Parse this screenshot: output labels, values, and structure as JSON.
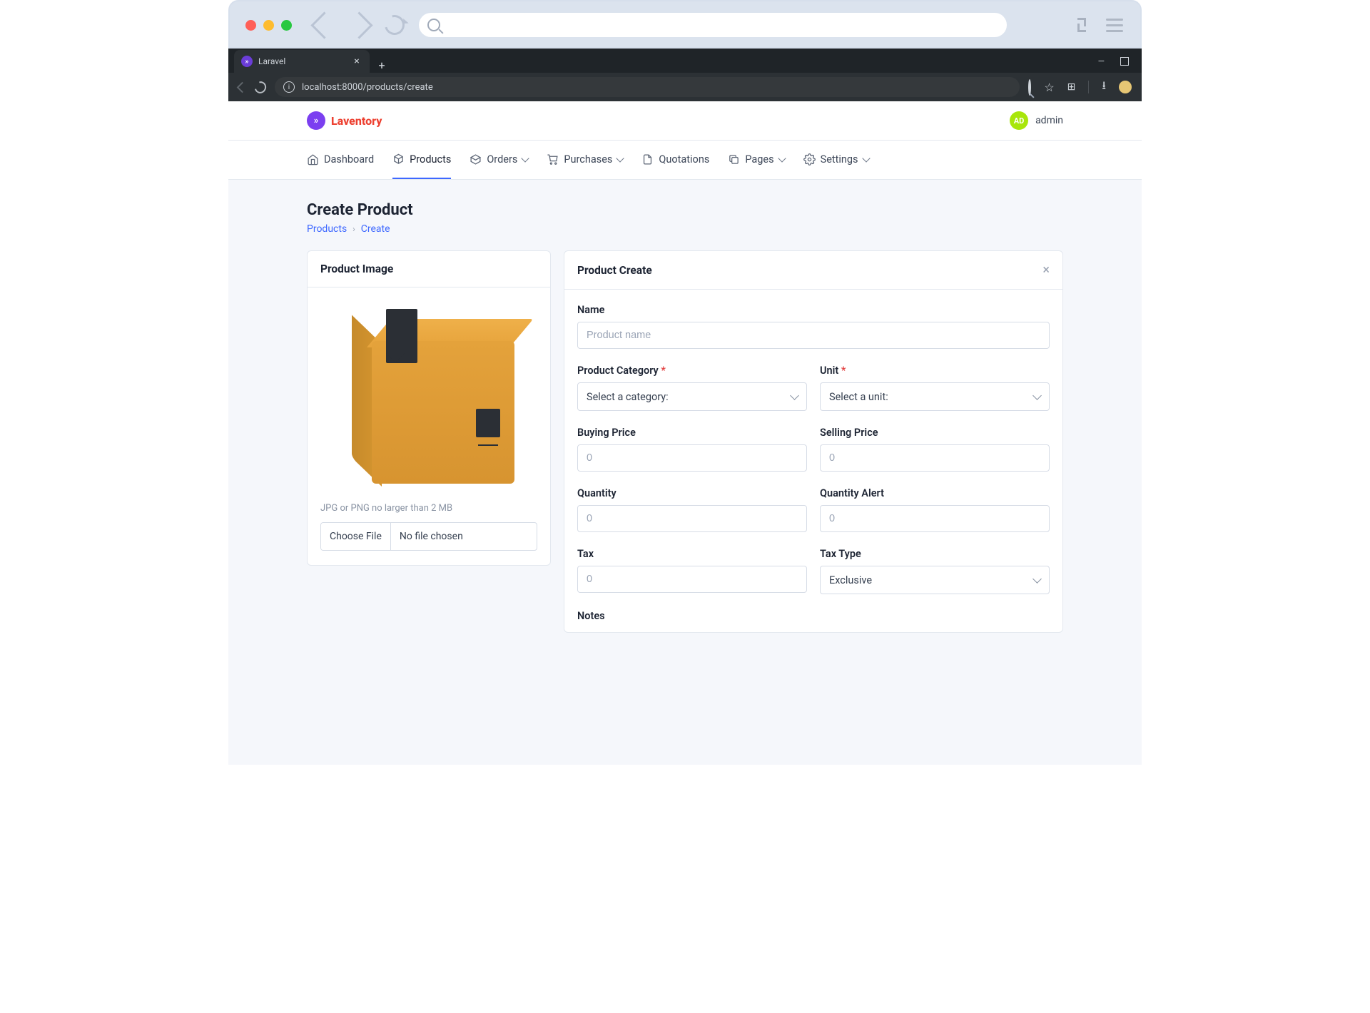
{
  "outer_browser": {
    "search_placeholder": ""
  },
  "inner_browser": {
    "tab_title": "Laravel",
    "url": "localhost:8000/products/create"
  },
  "header": {
    "brand": "Laventory",
    "user_initials": "AD",
    "user_name": "admin"
  },
  "nav": {
    "dashboard": "Dashboard",
    "products": "Products",
    "orders": "Orders",
    "purchases": "Purchases",
    "quotations": "Quotations",
    "pages": "Pages",
    "settings": "Settings"
  },
  "page": {
    "title": "Create Product",
    "breadcrumb": {
      "root": "Products",
      "current": "Create"
    }
  },
  "image_card": {
    "title": "Product Image",
    "hint": "JPG or PNG no larger than 2 MB",
    "choose_label": "Choose File",
    "no_file": "No file chosen"
  },
  "form": {
    "title": "Product Create",
    "name": {
      "label": "Name",
      "placeholder": "Product name",
      "value": ""
    },
    "category": {
      "label": "Product Category",
      "placeholder_option": "Select a category:"
    },
    "unit": {
      "label": "Unit",
      "placeholder_option": "Select a unit:"
    },
    "buying_price": {
      "label": "Buying Price",
      "placeholder": "0",
      "value": ""
    },
    "selling_price": {
      "label": "Selling Price",
      "placeholder": "0",
      "value": ""
    },
    "quantity": {
      "label": "Quantity",
      "placeholder": "0",
      "value": ""
    },
    "quantity_alert": {
      "label": "Quantity Alert",
      "placeholder": "0",
      "value": ""
    },
    "tax": {
      "label": "Tax",
      "placeholder": "0",
      "value": ""
    },
    "tax_type": {
      "label": "Tax Type",
      "selected": "Exclusive"
    },
    "notes": {
      "label": "Notes"
    }
  }
}
